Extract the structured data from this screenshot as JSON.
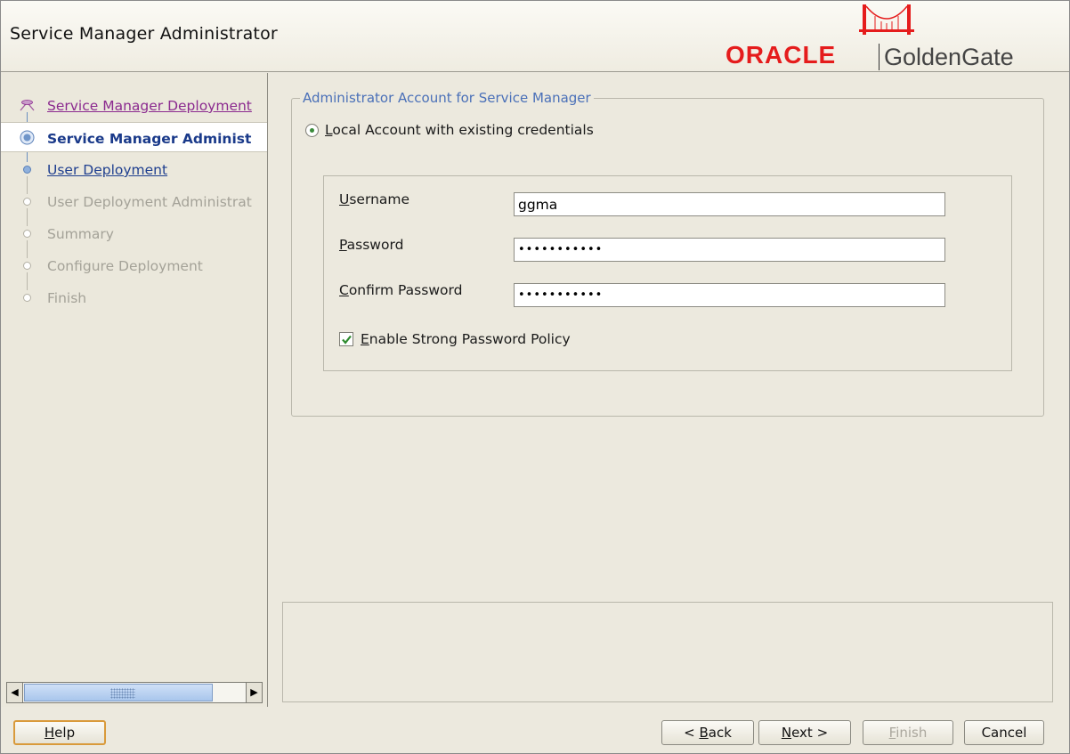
{
  "header": {
    "title": "Service Manager Administrator",
    "logo_primary": "ORACLE",
    "logo_secondary": "GoldenGate"
  },
  "nav": {
    "items": [
      {
        "label": "Service Manager Deployment",
        "state": "visited"
      },
      {
        "label": "Service Manager Administ",
        "state": "current"
      },
      {
        "label": "User Deployment",
        "state": "link"
      },
      {
        "label": "User Deployment Administrat",
        "state": "disabled"
      },
      {
        "label": "Summary",
        "state": "disabled"
      },
      {
        "label": "Configure Deployment",
        "state": "disabled"
      },
      {
        "label": "Finish",
        "state": "disabled"
      }
    ]
  },
  "form": {
    "group_title": "Administrator Account for Service Manager",
    "radio_option": {
      "mnemonic": "L",
      "rest": "ocal Account with existing credentials",
      "selected": true
    },
    "fields": [
      {
        "mnemonic": "U",
        "rest": "sername",
        "value": "ggma"
      },
      {
        "mnemonic": "P",
        "rest": "assword",
        "value": "•••••••••••"
      },
      {
        "mnemonic": "C",
        "rest": "onfirm Password",
        "value": "•••••••••••"
      }
    ],
    "strong_policy": {
      "mnemonic": "E",
      "rest": "nable Strong Password Policy",
      "checked": true
    }
  },
  "buttons": {
    "help": {
      "mnemonic": "H",
      "rest": "elp"
    },
    "back": {
      "prefix": "< ",
      "mnemonic": "B",
      "rest": "ack"
    },
    "next": {
      "mnemonic": "N",
      "rest": "ext >"
    },
    "finish": {
      "mnemonic": "F",
      "rest": "inish"
    },
    "cancel": {
      "label": "Cancel"
    }
  },
  "colors": {
    "accent_blue": "#4a70b8",
    "oracle_red": "#e51c1c",
    "visited_link": "#8b2a8f",
    "help_focus": "#d99a3b"
  }
}
